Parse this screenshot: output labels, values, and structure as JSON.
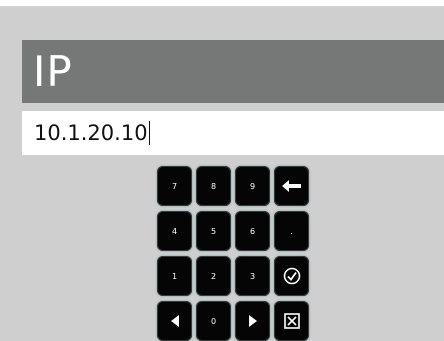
{
  "title": "IP",
  "ip_value": "10.1.20.10",
  "colors": {
    "background": "#cfcfcf",
    "title_bar": "#767777",
    "key": "#050505",
    "key_glow": "#6aa0a0"
  },
  "keypad": {
    "rows": [
      [
        {
          "label": "7",
          "icon": null
        },
        {
          "label": "8",
          "icon": null
        },
        {
          "label": "9",
          "icon": null
        },
        {
          "label": "",
          "icon": "backspace-arrow-icon"
        }
      ],
      [
        {
          "label": "4",
          "icon": null
        },
        {
          "label": "5",
          "icon": null
        },
        {
          "label": "6",
          "icon": null
        },
        {
          "label": ".",
          "icon": null
        }
      ],
      [
        {
          "label": "1",
          "icon": null
        },
        {
          "label": "2",
          "icon": null
        },
        {
          "label": "3",
          "icon": null
        },
        {
          "label": "",
          "icon": "confirm-check-icon"
        }
      ],
      [
        {
          "label": "",
          "icon": "arrow-left-icon"
        },
        {
          "label": "0",
          "icon": null
        },
        {
          "label": "",
          "icon": "arrow-right-icon"
        },
        {
          "label": "",
          "icon": "cancel-x-icon"
        }
      ]
    ]
  }
}
